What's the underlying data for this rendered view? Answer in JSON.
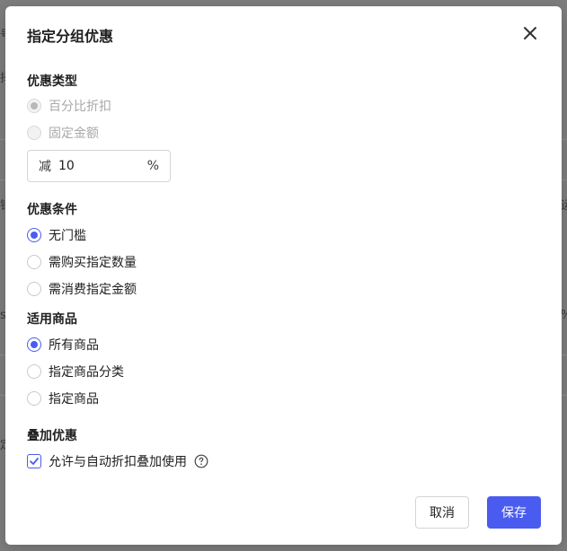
{
  "modal": {
    "title": "指定分组优惠"
  },
  "discount_type": {
    "title": "优惠类型",
    "options": [
      {
        "label": "百分比折扣",
        "checked": true,
        "disabled": true
      },
      {
        "label": "固定金额",
        "checked": false,
        "disabled": true
      }
    ],
    "input": {
      "prefix": "减",
      "value": "10",
      "suffix": "%"
    }
  },
  "condition": {
    "title": "优惠条件",
    "options": [
      {
        "label": "无门槛",
        "checked": true
      },
      {
        "label": "需购买指定数量",
        "checked": false
      },
      {
        "label": "需消费指定金额",
        "checked": false
      }
    ]
  },
  "products": {
    "title": "适用商品",
    "options": [
      {
        "label": "所有商品",
        "checked": true
      },
      {
        "label": "指定商品分类",
        "checked": false
      },
      {
        "label": "指定商品",
        "checked": false
      }
    ]
  },
  "stacking": {
    "title": "叠加优惠",
    "checkbox_label": "允许与自动折扣叠加使用",
    "checked": true
  },
  "footer": {
    "cancel_label": "取消",
    "save_label": "保存"
  },
  "colors": {
    "accent": "#4a5cf0"
  },
  "background": {
    "glyphs": [
      "号",
      "择",
      "销",
      "s",
      "定",
      "运",
      "%"
    ]
  }
}
